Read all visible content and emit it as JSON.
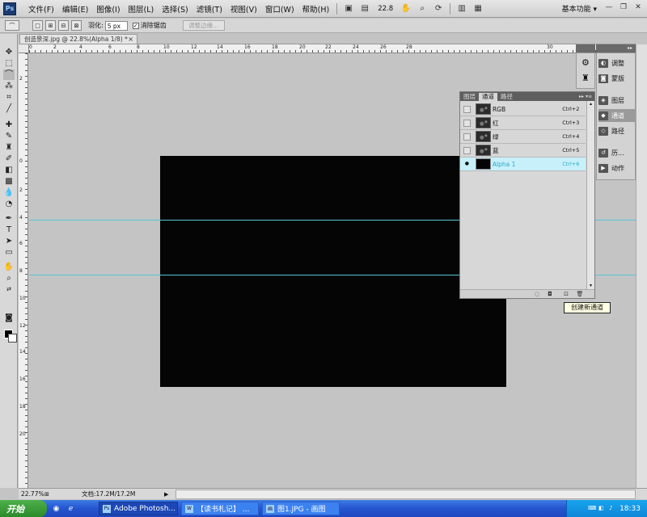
{
  "menubar": {
    "logo": "Ps",
    "items": [
      "文件(F)",
      "编辑(E)",
      "图像(I)",
      "图层(L)",
      "选择(S)",
      "滤镜(T)",
      "视图(V)",
      "窗口(W)",
      "帮助(H)"
    ],
    "zoom": "22.8",
    "workspace": "基本功能 ▾",
    "minimize": "—",
    "restore": "❐",
    "close": "✕"
  },
  "options": {
    "feather_label": "羽化:",
    "feather_value": "5 px",
    "antialias_label": "消除锯齿",
    "refine_label": "调整边缘..."
  },
  "document": {
    "tab_title": "创造景深.jpg @ 22.8%(Alpha 1/8) *",
    "close": "×"
  },
  "rulers": {
    "h": [
      "0",
      "2",
      "4",
      "6",
      "8",
      "10",
      "12",
      "14",
      "16",
      "18",
      "20",
      "22",
      "24",
      "26",
      "28",
      "30"
    ],
    "v": [
      "2",
      "0",
      "2",
      "4",
      "6",
      "8",
      "10",
      "12",
      "14",
      "16",
      "18",
      "20"
    ]
  },
  "dock": {
    "items": [
      {
        "icon": "◐",
        "label": "调整"
      },
      {
        "icon": "◙",
        "label": "蒙版"
      },
      {
        "icon": "◈",
        "label": "图层"
      },
      {
        "icon": "◆",
        "label": "通道"
      },
      {
        "icon": "◇",
        "label": "路径"
      },
      {
        "icon": "↺",
        "label": "历..."
      },
      {
        "icon": "▶",
        "label": "动作"
      }
    ]
  },
  "channels": {
    "tabs": [
      "图层",
      "通道",
      "路径"
    ],
    "menu": "▸▸ ▾≡",
    "rows": [
      {
        "name": "RGB",
        "shortcut": "Ctrl+2",
        "eye": ""
      },
      {
        "name": "红",
        "shortcut": "Ctrl+3",
        "eye": ""
      },
      {
        "name": "绿",
        "shortcut": "Ctrl+4",
        "eye": ""
      },
      {
        "name": "蓝",
        "shortcut": "Ctrl+5",
        "eye": ""
      },
      {
        "name": "Alpha 1",
        "shortcut": "Ctrl+6",
        "eye": "●"
      }
    ]
  },
  "tooltip": "创建新通道",
  "status": {
    "zoom": "22.77%",
    "doc": "文档:17.2M/17.2M"
  },
  "taskbar": {
    "start": "开始",
    "tasks": [
      {
        "icon": "Ps",
        "label": "Adobe Photosh...",
        "active": true
      },
      {
        "icon": "W",
        "label": "【读书札记】 ...",
        "active": false
      },
      {
        "icon": "画",
        "label": "图1.JPG - 画图",
        "active": false
      }
    ],
    "clock": "18:33"
  },
  "colors": {
    "guide": "#58c6d6",
    "selected_row": "#c8f0fb"
  }
}
